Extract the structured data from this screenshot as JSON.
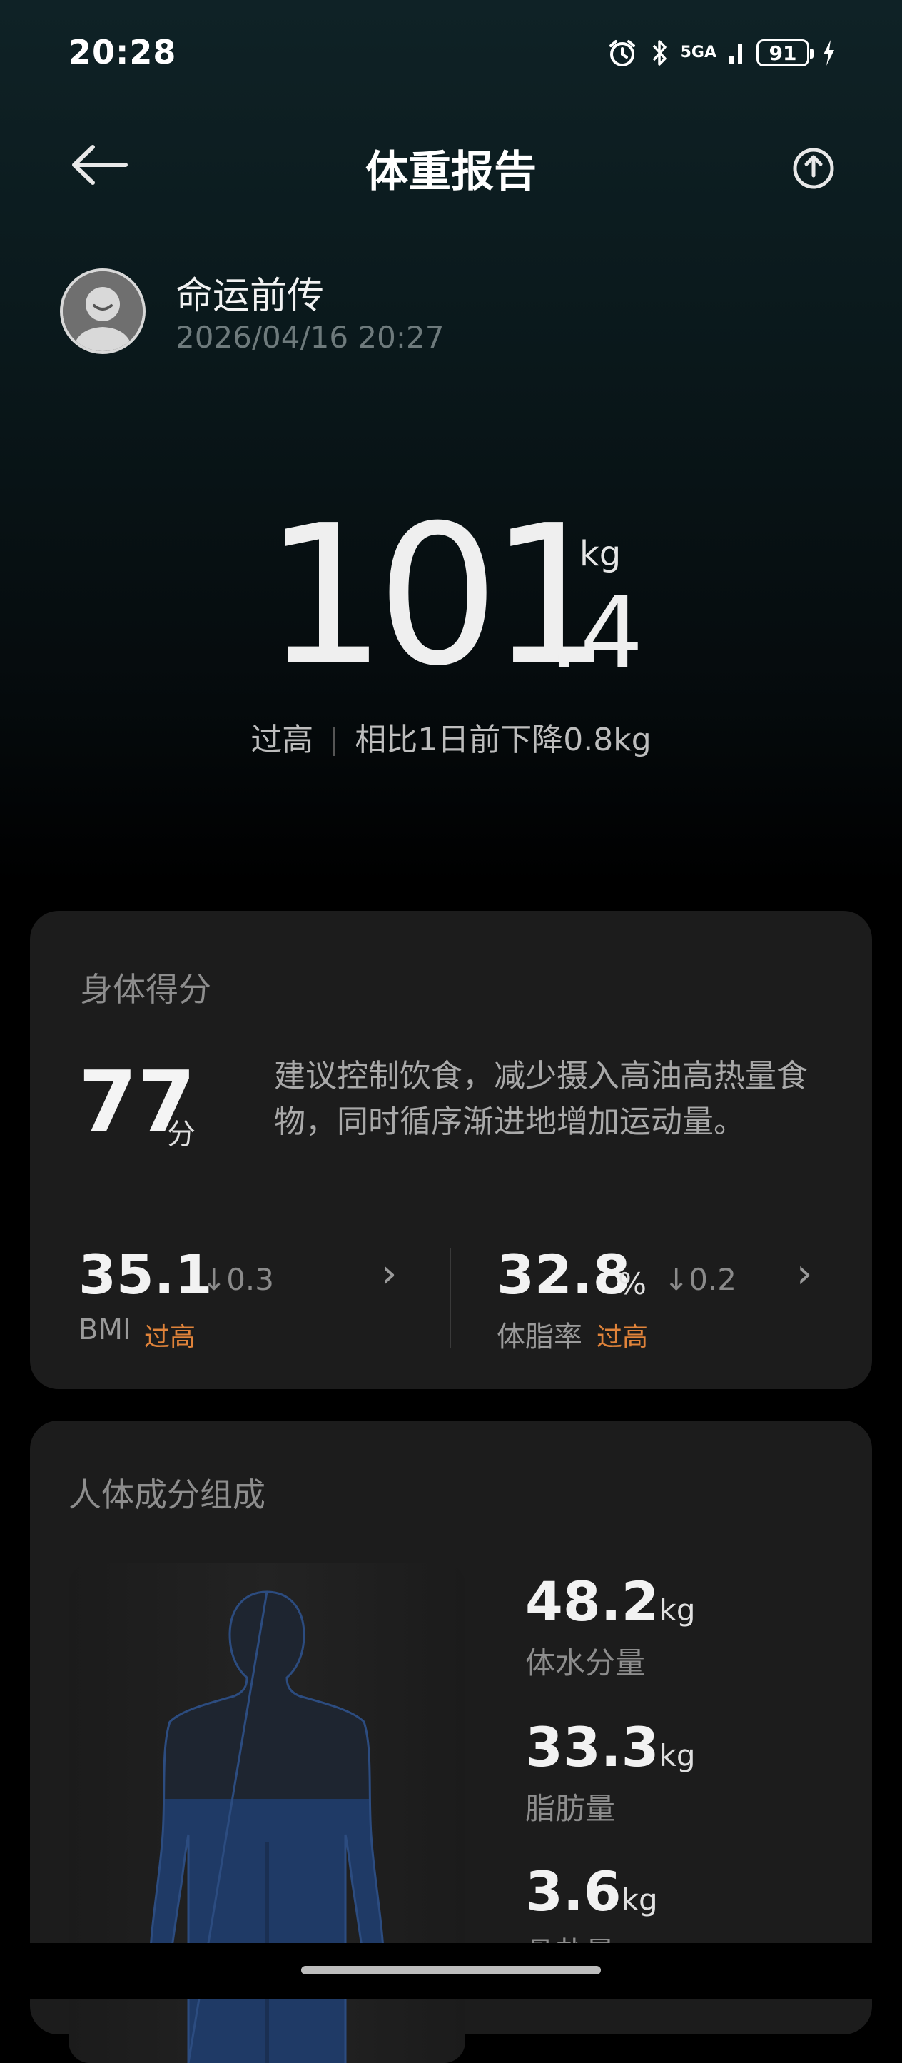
{
  "status_bar": {
    "time": "20:28",
    "network": "5GA",
    "battery": "91",
    "icons": [
      "alarm-icon",
      "bluetooth-icon",
      "signal-icon",
      "battery-icon",
      "charging-icon"
    ]
  },
  "header": {
    "title": "体重报告",
    "back_icon": "arrow-left-icon",
    "share_icon": "share-upload-icon"
  },
  "user": {
    "name": "命运前传",
    "datetime": "2026/04/16 20:27"
  },
  "weight": {
    "integer": "101",
    "decimal": ".4",
    "unit": "kg",
    "status": "过高",
    "comparison": "相比1日前下降0.8kg"
  },
  "body_score": {
    "title": "身体得分",
    "score": "77",
    "score_unit": "分",
    "advice": "建议控制饮食，减少摄入高油高热量食物，同时循序渐进地增加运动量。",
    "metrics": [
      {
        "value": "35.1",
        "unit": "",
        "delta": "0.3",
        "label": "BMI",
        "status": "过高"
      },
      {
        "value": "32.8",
        "unit": "%",
        "delta": "0.2",
        "label": "体脂率",
        "status": "过高"
      }
    ]
  },
  "composition": {
    "title": "人体成分组成",
    "items": [
      {
        "value": "48.2",
        "unit": "kg",
        "label": "体水分量"
      },
      {
        "value": "33.3",
        "unit": "kg",
        "label": "脂肪量"
      },
      {
        "value": "3.6",
        "unit": "kg",
        "label": "骨盐量"
      }
    ]
  },
  "colors": {
    "status_warning": "#e0833a",
    "card_bg": "#1c1c1c",
    "body_highlight": "#1f3a66"
  }
}
